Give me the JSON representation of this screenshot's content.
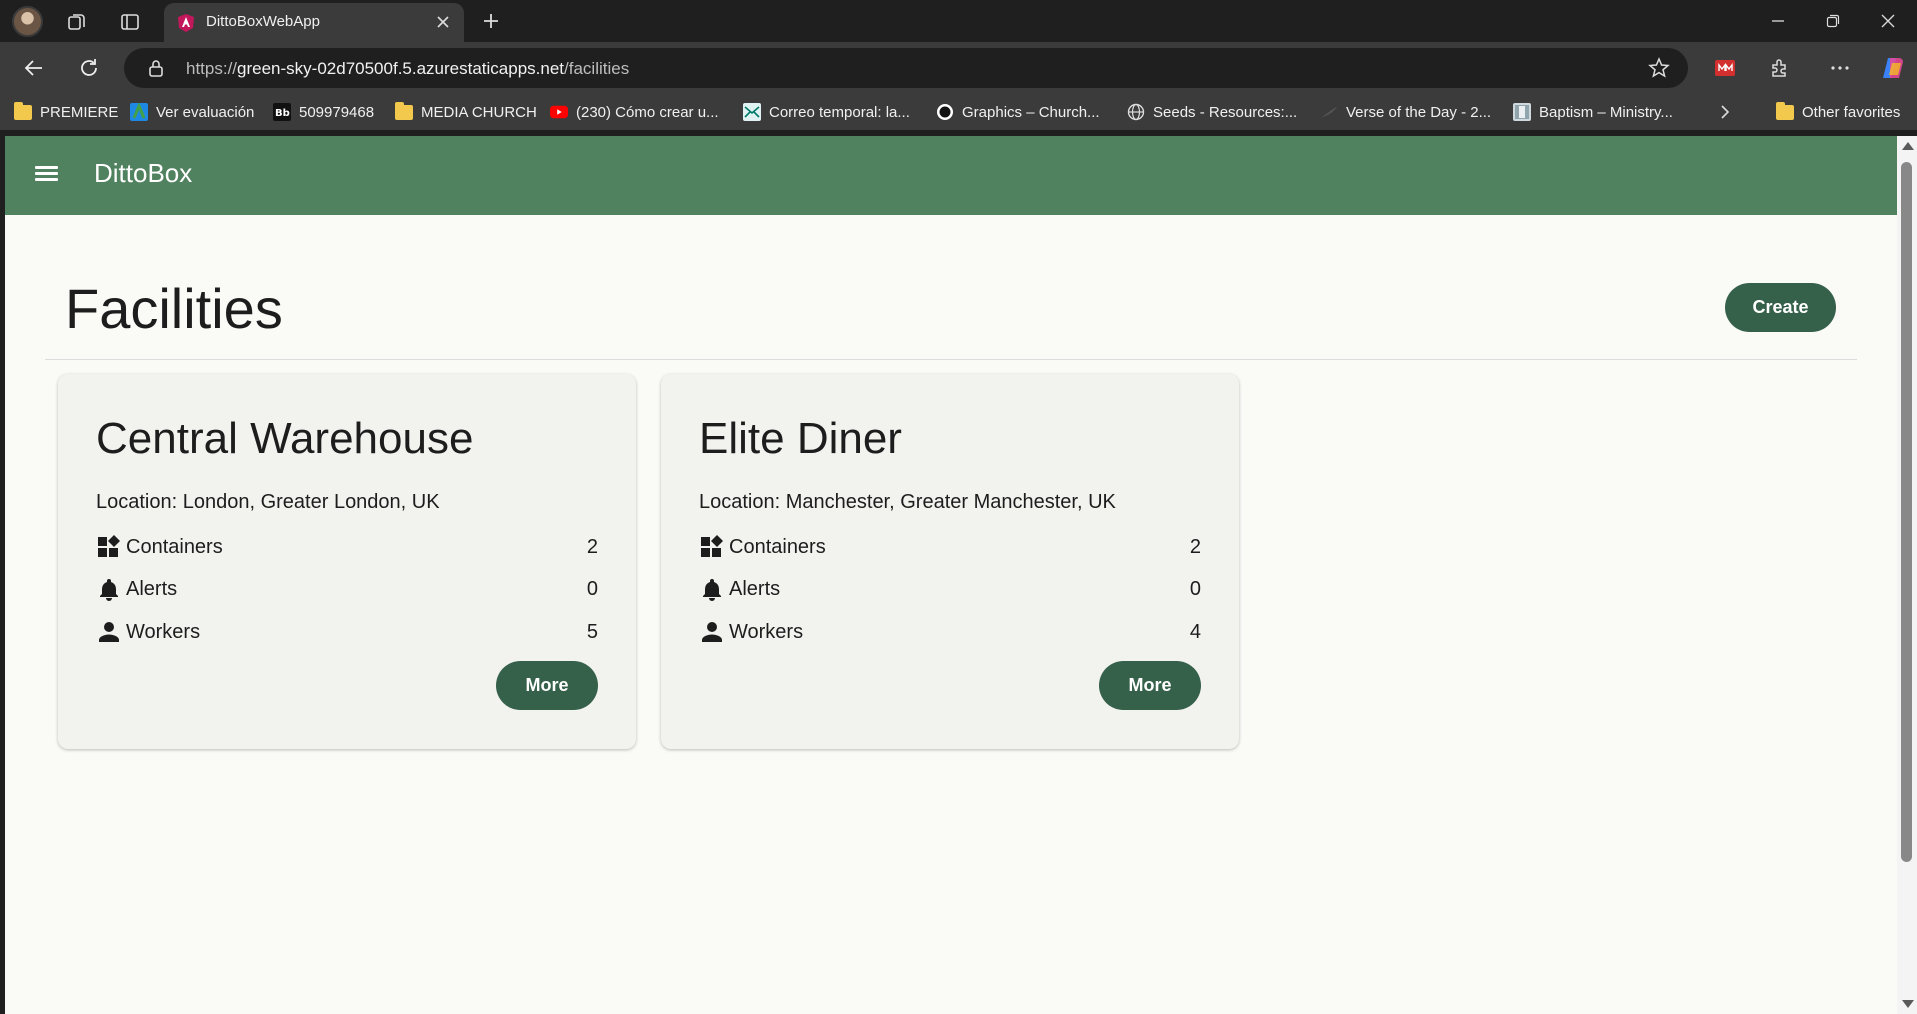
{
  "browser": {
    "tab_title": "DittoBoxWebApp",
    "url_scheme": "https://",
    "url_host": "green-sky-02d70500f.5.azurestaticapps.net",
    "url_path": "/facilities",
    "bookmarks": [
      {
        "label": "PREMIERE",
        "icon": "folder-icon"
      },
      {
        "label": "Ver evaluación",
        "icon": "app-icon"
      },
      {
        "label": "509979468",
        "icon": "bb-icon"
      },
      {
        "label": "MEDIA CHURCH",
        "icon": "folder-icon"
      },
      {
        "label": "(230) Cómo crear u...",
        "icon": "youtube-icon"
      },
      {
        "label": "Correo temporal: la...",
        "icon": "mail-icon"
      },
      {
        "label": "Graphics – Church...",
        "icon": "circle-icon"
      },
      {
        "label": "Seeds - Resources:...",
        "icon": "globe-icon"
      },
      {
        "label": "Verse of the Day - 2...",
        "icon": "feather-icon"
      },
      {
        "label": "Baptism – Ministry...",
        "icon": "image-icon"
      }
    ],
    "other_favorites": "Other favorites"
  },
  "app": {
    "title": "DittoBox",
    "page_title": "Facilities",
    "create_label": "Create",
    "accent_color": "#35604a",
    "appbar_color": "#51825f"
  },
  "facilities": [
    {
      "name": "Central Warehouse",
      "location": "Location: London, Greater London, UK",
      "stats": [
        {
          "label": "Containers",
          "value": "2",
          "icon": "widgets-icon"
        },
        {
          "label": "Alerts",
          "value": "0",
          "icon": "bell-icon"
        },
        {
          "label": "Workers",
          "value": "5",
          "icon": "person-icon"
        }
      ],
      "more_label": "More"
    },
    {
      "name": "Elite Diner",
      "location": "Location: Manchester, Greater Manchester, UK",
      "stats": [
        {
          "label": "Containers",
          "value": "2",
          "icon": "widgets-icon"
        },
        {
          "label": "Alerts",
          "value": "0",
          "icon": "bell-icon"
        },
        {
          "label": "Workers",
          "value": "4",
          "icon": "person-icon"
        }
      ],
      "more_label": "More"
    }
  ]
}
